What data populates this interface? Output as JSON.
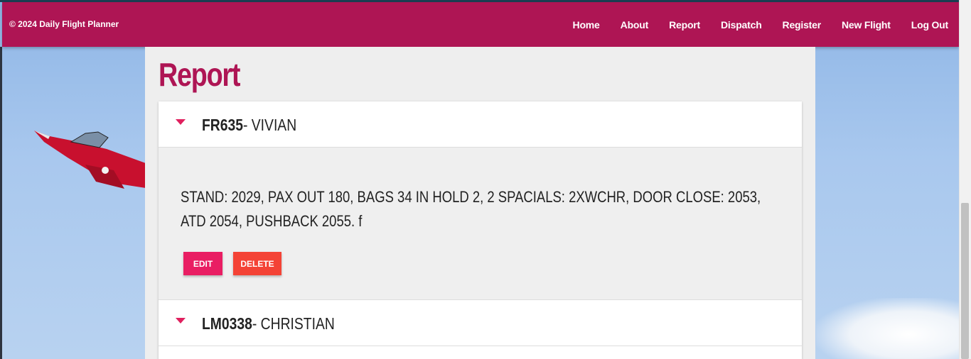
{
  "brand": {
    "copyright": "© 2024 Daily Flight Planner"
  },
  "nav": {
    "items": [
      "Home",
      "About",
      "Report",
      "Dispatch",
      "Register",
      "New Flight",
      "Log Out"
    ]
  },
  "page": {
    "title": "Report"
  },
  "reports": [
    {
      "flight": "FR635",
      "name": "- VIVIAN",
      "text": "STAND: 2029, PAX OUT 180, BAGS 34 IN HOLD 2, 2 SPACIALS: 2XWCHR, DOOR CLOSE: 2053, ATD 2054, PUSHBACK 2055. f",
      "edit_label": "EDIT",
      "delete_label": "DELETE",
      "expanded": true
    },
    {
      "flight": "LM0338",
      "name": "- CHRISTIAN",
      "expanded": false
    }
  ],
  "colors": {
    "brand": "#ae1554",
    "caret": "#e0205e",
    "edit_button": "#e91e63",
    "delete_button": "#f44336"
  },
  "icons": {
    "accordion_toggle": "caret-down-icon"
  }
}
